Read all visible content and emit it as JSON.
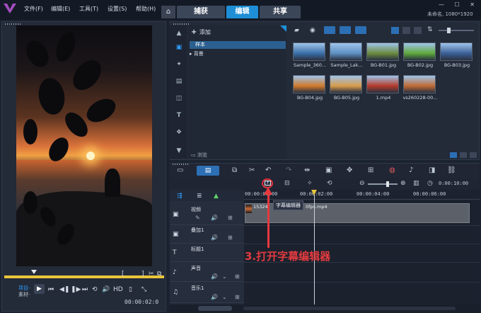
{
  "menu": [
    "文件(F)",
    "编辑(E)",
    "工具(T)",
    "设置(S)",
    "帮助(H)"
  ],
  "tabs": {
    "home": "⌂",
    "capture": "捕获",
    "edit": "编辑",
    "share": "共享"
  },
  "window": {
    "controls": "— ☐ ✕",
    "doc_info": "未命名, 1080*1920"
  },
  "library": {
    "add_label": "添加",
    "folders": [
      "样本",
      "背景"
    ],
    "browse_label": "浏览",
    "thumbnails": [
      {
        "label": "Sample_360...",
        "color": "#3a6ea8"
      },
      {
        "label": "Sample_Lak...",
        "color": "#5d8fc2"
      },
      {
        "label": "BG-B01.jpg",
        "color": "#6a8b3e"
      },
      {
        "label": "BG-B02.jpg",
        "color": "#5fa83a"
      },
      {
        "label": "BG-B03.jpg",
        "color": "#3a5f96"
      },
      {
        "label": "BG-B04.jpg",
        "color": "#d07a2a"
      },
      {
        "label": "BG-B05.jpg",
        "color": "#d89c4a"
      },
      {
        "label": "1.mp4",
        "color": "#b43a2a"
      },
      {
        "label": "vs260228-00...",
        "color": "#c06a34"
      }
    ]
  },
  "player": {
    "label_project": "项目-",
    "label_material": "素材-",
    "play": "▶",
    "hd": "HD",
    "timecode": "00:00:02:0",
    "in_mark": "[",
    "out_mark": "]"
  },
  "timeline": {
    "ruler": [
      "00:00:00:00",
      "00:00:02:00",
      "00:00:04:00",
      "00:00:06:00"
    ],
    "zoom_time": "0:00:10:00",
    "tracks": [
      {
        "name": "视频",
        "icon": "▣"
      },
      {
        "name": "叠加1",
        "icon": "▣"
      },
      {
        "name": "标题1",
        "icon": "T"
      },
      {
        "name": "声音",
        "icon": "♪"
      },
      {
        "name": "音乐1",
        "icon": "♫"
      }
    ],
    "clip_text": "15324",
    "clip_suffix": "0fps.mp4",
    "tooltip": "字幕编辑器"
  },
  "annotation": "3.打开字幕编辑器"
}
